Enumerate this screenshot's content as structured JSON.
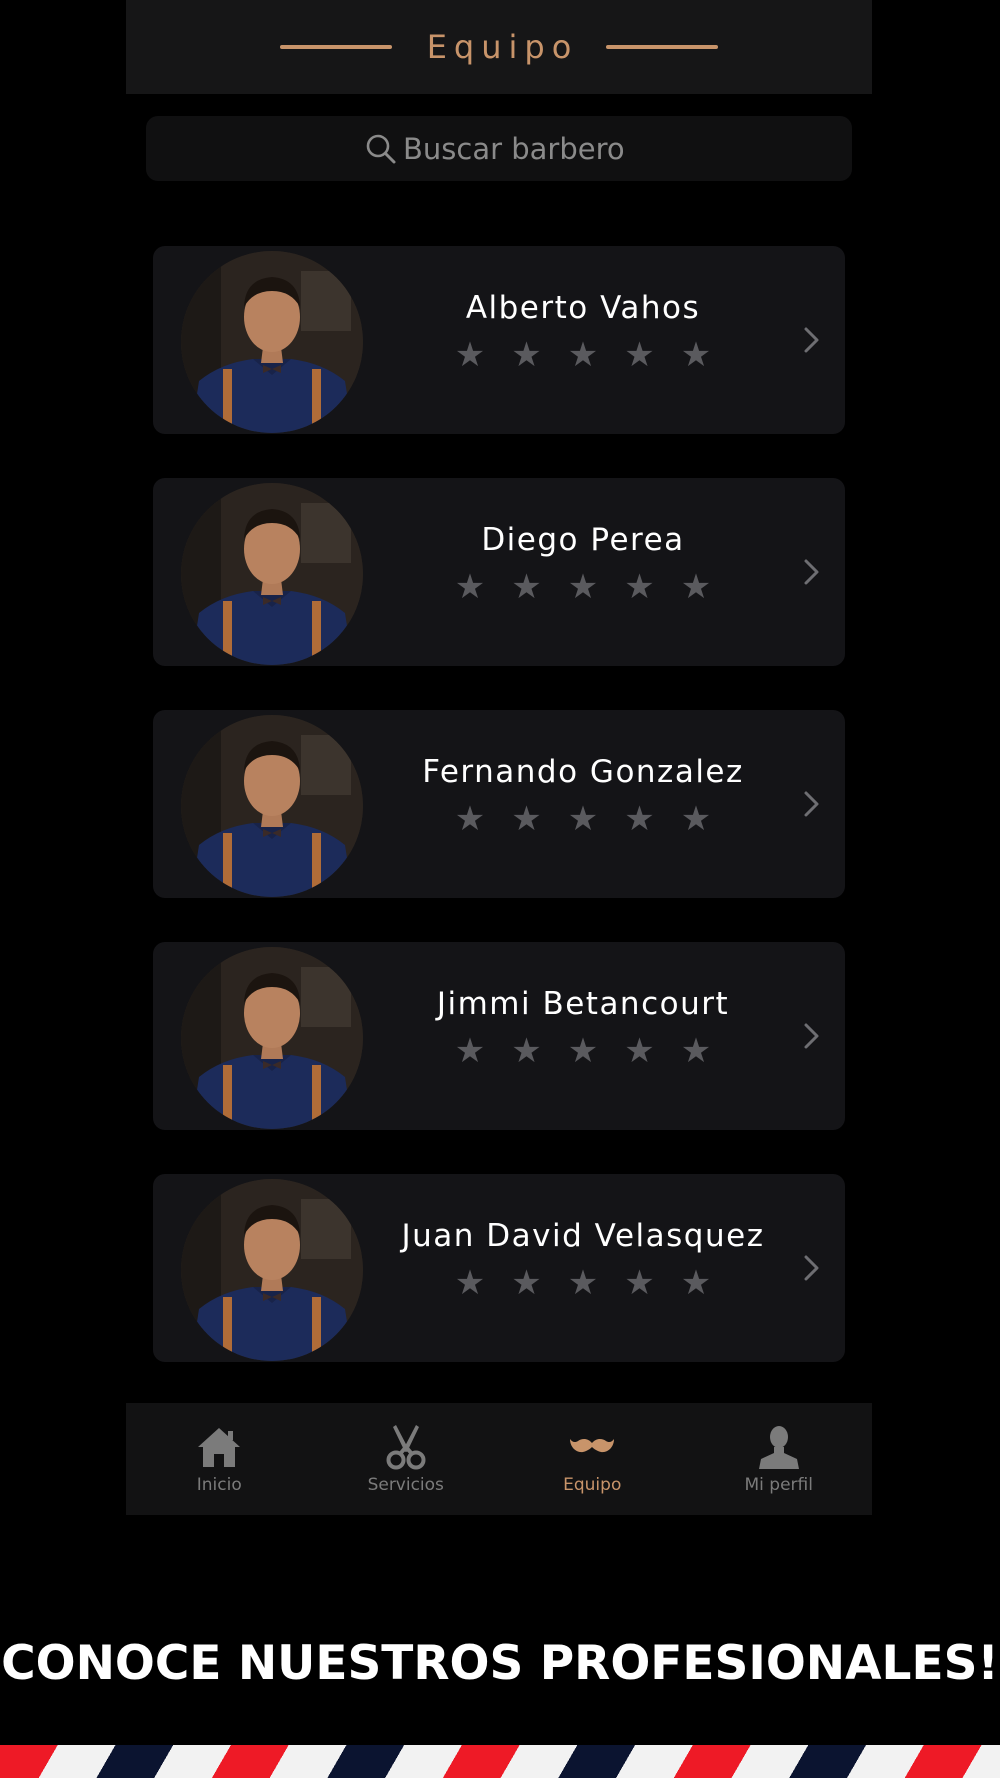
{
  "header": {
    "title": "Equipo"
  },
  "search": {
    "placeholder": "Buscar barbero"
  },
  "barbers": [
    {
      "name": "Alberto Vahos",
      "rating": 0,
      "max_rating": 5
    },
    {
      "name": "Diego Perea",
      "rating": 0,
      "max_rating": 5
    },
    {
      "name": "Fernando Gonzalez",
      "rating": 0,
      "max_rating": 5
    },
    {
      "name": "Jimmi Betancourt",
      "rating": 0,
      "max_rating": 5
    },
    {
      "name": "Juan David Velasquez",
      "rating": 0,
      "max_rating": 5
    }
  ],
  "tabbar": {
    "items": [
      {
        "label": "Inicio",
        "icon": "home-icon",
        "active": false
      },
      {
        "label": "Servicios",
        "icon": "scissors-icon",
        "active": false
      },
      {
        "label": "Equipo",
        "icon": "mustache-icon",
        "active": true
      },
      {
        "label": "Mi perfil",
        "icon": "user-icon",
        "active": false
      }
    ]
  },
  "banner": {
    "text": "CONOCE NUESTROS PROFESIONALES!"
  },
  "colors": {
    "accent": "#c8946a",
    "background": "#000000",
    "card": "#141417",
    "star_inactive": "#5a5a5e",
    "tab_inactive": "#7b7b7b"
  }
}
